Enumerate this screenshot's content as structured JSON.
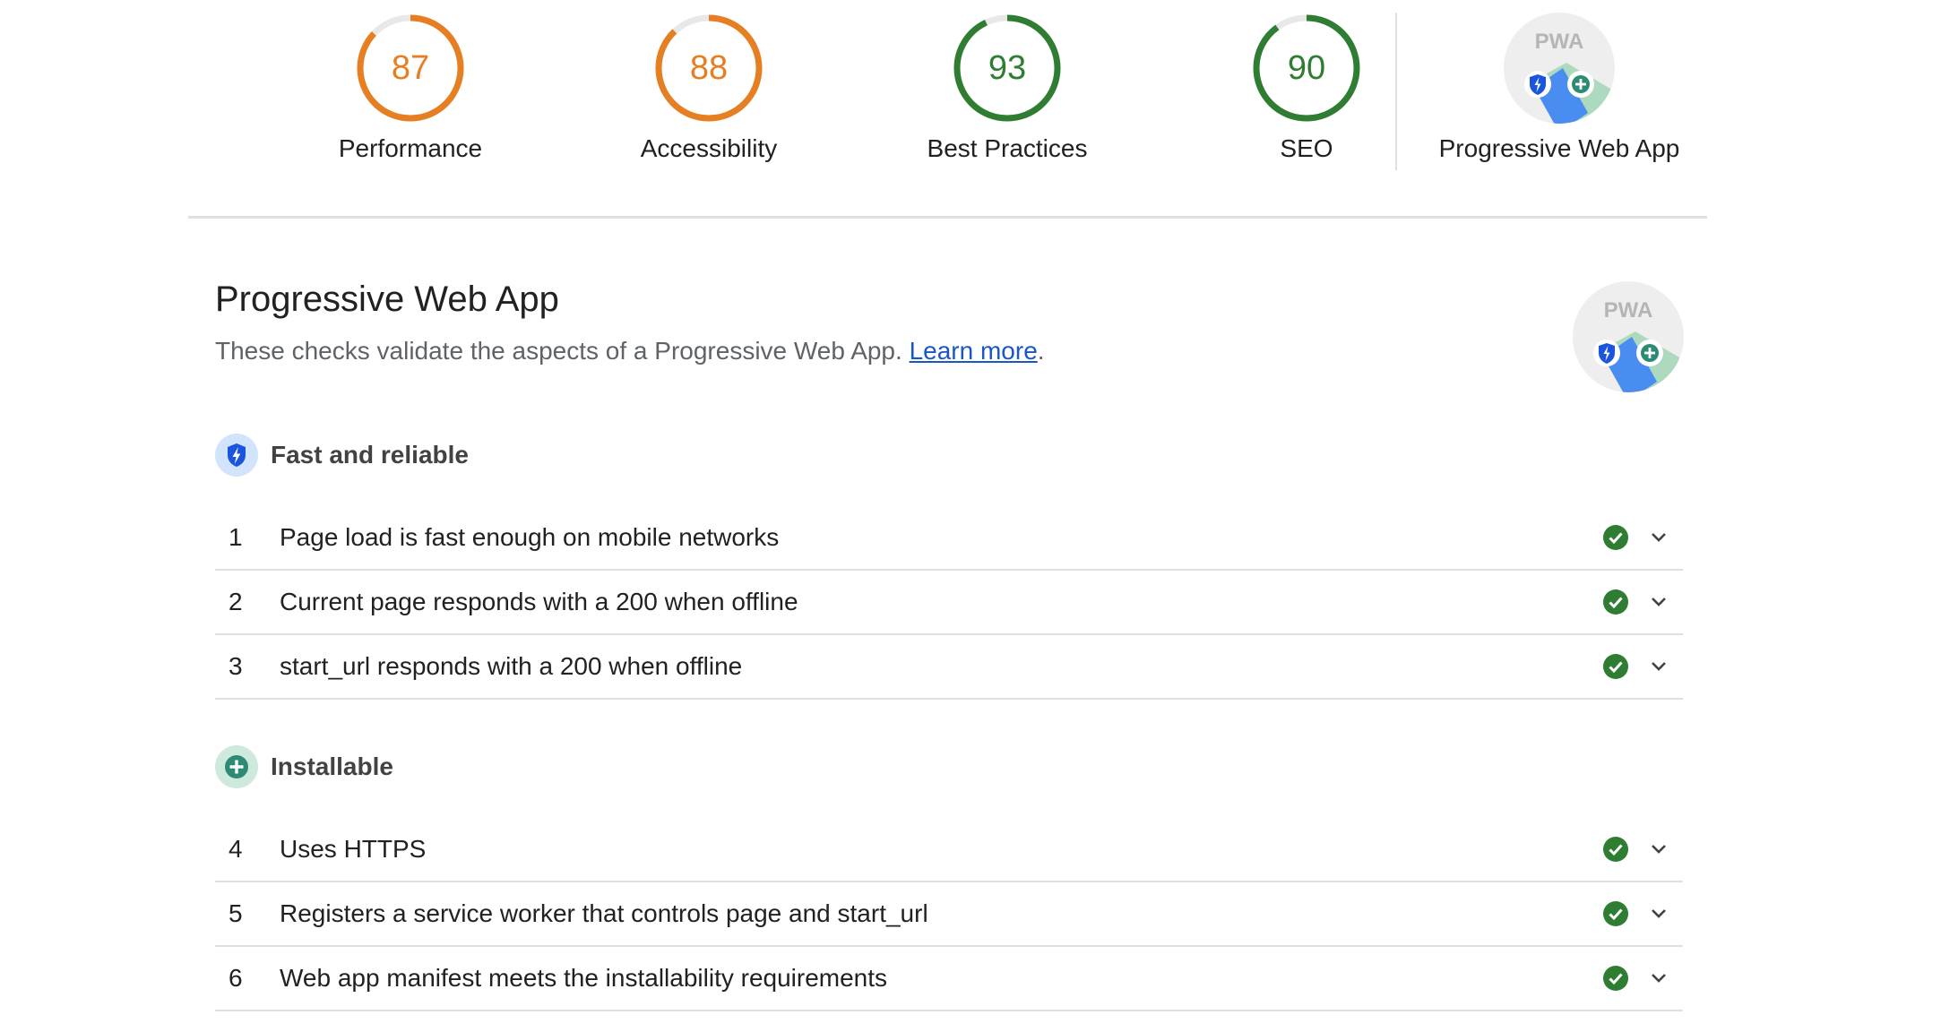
{
  "colors": {
    "average": "#e67e22",
    "pass": "#2e7d32",
    "track": "#e8e8e8",
    "link": "#1a56c9",
    "pwa_blue": "#1a56dd",
    "pwa_green": "#2e8b73"
  },
  "gauges": [
    {
      "score": 87,
      "display": "87",
      "label": "Performance",
      "rating": "average"
    },
    {
      "score": 88,
      "display": "88",
      "label": "Accessibility",
      "rating": "average"
    },
    {
      "score": 93,
      "display": "93",
      "label": "Best Practices",
      "rating": "pass"
    },
    {
      "score": 90,
      "display": "90",
      "label": "SEO",
      "rating": "pass"
    }
  ],
  "pwa_gauge": {
    "label": "Progressive Web App",
    "badge_text": "PWA"
  },
  "category": {
    "title": "Progressive Web App",
    "description": "These checks validate the aspects of a Progressive Web App.",
    "learn_more": "Learn more",
    "after_link": ".",
    "badge_text": "PWA"
  },
  "groups": [
    {
      "title": "Fast and reliable",
      "icon": "lightning-shield-icon",
      "audits": [
        {
          "num": "1",
          "title": "Page load is fast enough on mobile networks",
          "status": "pass"
        },
        {
          "num": "2",
          "title": "Current page responds with a 200 when offline",
          "status": "pass"
        },
        {
          "num": "3",
          "title": "start_url responds with a 200 when offline",
          "status": "pass"
        }
      ]
    },
    {
      "title": "Installable",
      "icon": "plus-circle-icon",
      "audits": [
        {
          "num": "4",
          "title": "Uses HTTPS",
          "status": "pass"
        },
        {
          "num": "5",
          "title": "Registers a service worker that controls page and start_url",
          "status": "pass"
        },
        {
          "num": "6",
          "title": "Web app manifest meets the installability requirements",
          "status": "pass"
        }
      ]
    }
  ]
}
